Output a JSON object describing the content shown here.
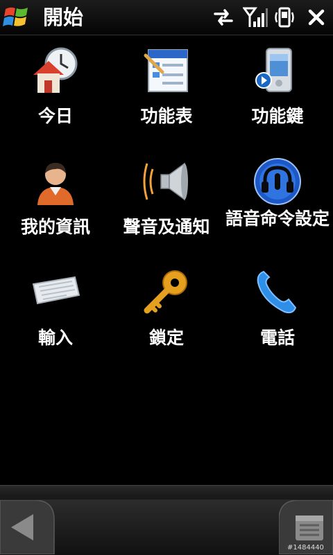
{
  "titlebar": {
    "title": "開始",
    "icons": [
      "windows-start-icon",
      "sync-arrows-icon",
      "signal-icon",
      "vibrate-icon",
      "close-icon"
    ]
  },
  "tiles": [
    {
      "label": "今日",
      "icon": "today-house-clock-icon"
    },
    {
      "label": "功能表",
      "icon": "program-menu-icon"
    },
    {
      "label": "功能鍵",
      "icon": "device-buttons-icon"
    },
    {
      "label": "我的資訊",
      "icon": "person-icon"
    },
    {
      "label": "聲音及通知",
      "icon": "speaker-icon"
    },
    {
      "label": "語音命令設定",
      "icon": "voice-command-headset-icon"
    },
    {
      "label": "輸入",
      "icon": "keyboard-icon"
    },
    {
      "label": "鎖定",
      "icon": "key-icon"
    },
    {
      "label": "電話",
      "icon": "phone-icon"
    }
  ],
  "bottombar": {
    "icons": [
      "back-arrow-icon",
      "menu-list-icon"
    ]
  },
  "watermark": "#1484440"
}
